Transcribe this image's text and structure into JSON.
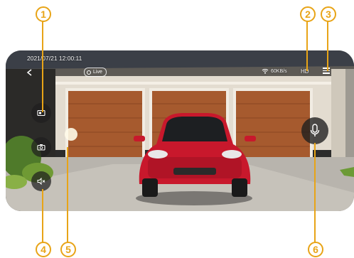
{
  "callouts": [
    "1",
    "2",
    "3",
    "4",
    "5",
    "6"
  ],
  "video": {
    "timestamp": "2021/07/21  12:00:11",
    "live_label": "Live",
    "network_speed": "60KB/s",
    "quality_label": "HD"
  },
  "icons": {
    "back": "chevron-left-icon",
    "live": "live-dot-icon",
    "wifi": "wifi-icon",
    "menu": "menu-icon",
    "fullscreen": "screen-toggle-icon",
    "snapshot": "camera-icon",
    "mute": "speaker-mute-icon",
    "talk": "microphone-icon"
  },
  "colors": {
    "callout": "#e8a417",
    "car": "#c8182c",
    "garage_door": "#a65a2e",
    "house_wall": "#e3dcd0"
  }
}
